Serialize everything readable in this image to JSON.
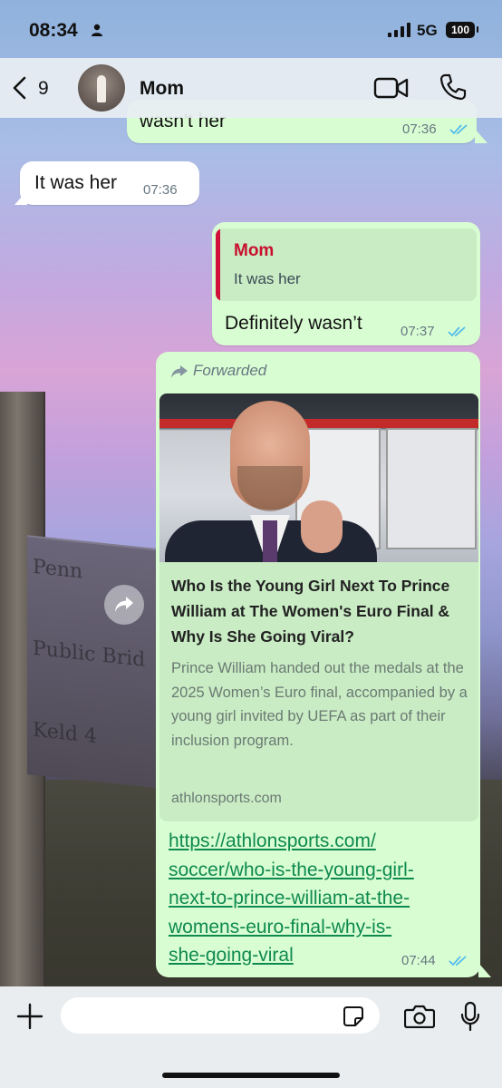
{
  "status_bar": {
    "time": "08:34",
    "network": "5G",
    "battery": "100"
  },
  "header": {
    "back_count": "9",
    "contact_name": "Mom"
  },
  "messages": [
    {
      "direction": "out",
      "text": "wasn't her",
      "time": "07:36"
    },
    {
      "direction": "in",
      "text": "It was her",
      "time": "07:36"
    },
    {
      "direction": "out",
      "quote_author": "Mom",
      "quote_text": "It was her",
      "text": "Definitely wasn’t",
      "time": "07:37"
    },
    {
      "direction": "out",
      "forwarded_label": "Forwarded",
      "preview_title": "Who Is the Young Girl Next To Prince William at The Women's Euro Final & Why Is She Going Viral?",
      "preview_description": "Prince William handed out the medals at the 2025 Women’s Euro final, accompanied by a young girl invited by UEFA as part of their inclusion program.",
      "preview_domain": "athlonsports.com",
      "link": "https://athlonsports.com/soccer/who-is-the-young-girl-next-to-prince-william-at-the-womens-euro-final-why-is-she-going-viral",
      "time": "07:44"
    }
  ],
  "composer": {
    "placeholder": ""
  },
  "colors": {
    "outgoing_bubble": "#d9fdd3",
    "incoming_bubble": "#ffffff",
    "read_ticks": "#53bdeb",
    "link": "#0f8a4f",
    "quote_name": "#c8102e"
  },
  "icons": [
    "person-icon",
    "signal-icon",
    "back-chevron-icon",
    "video-call-icon",
    "phone-icon",
    "double-check-icon",
    "forward-icon",
    "share-icon",
    "plus-icon",
    "sticker-icon",
    "camera-icon",
    "mic-icon"
  ]
}
